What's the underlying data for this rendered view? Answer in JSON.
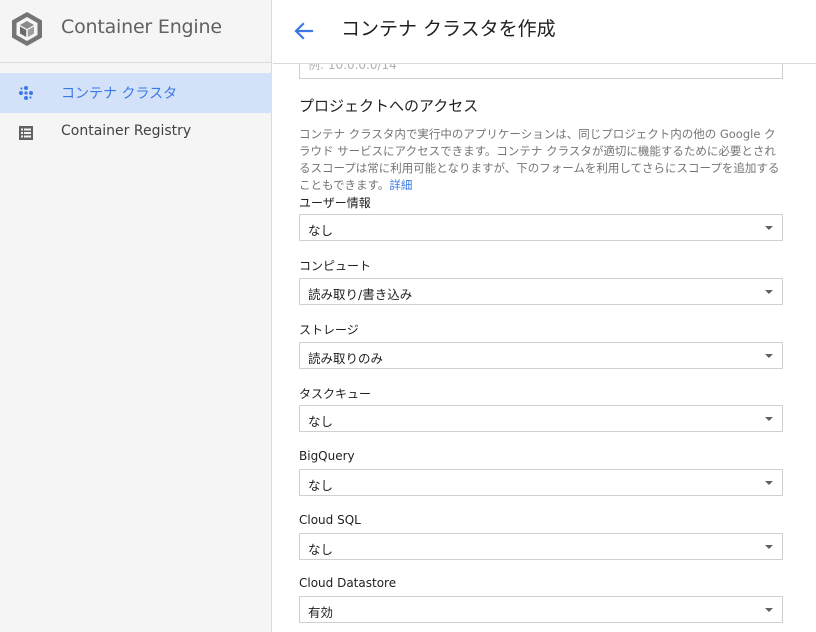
{
  "sidebar": {
    "app_title": "Container Engine",
    "items": [
      {
        "label": "コンテナ クラスタ",
        "icon": "cluster-icon",
        "active": true
      },
      {
        "label": "Container Registry",
        "icon": "registry-list-icon",
        "active": false
      }
    ]
  },
  "header": {
    "title": "コンテナ クラスタを作成",
    "back_icon": "arrow-back-icon"
  },
  "form": {
    "ip_placeholder": "例: 10.0.0.0/14",
    "access_section": {
      "title": "プロジェクトへのアクセス",
      "description": "コンテナ クラスタ内で実行中のアプリケーションは、同じプロジェクト内の他の Google クラウド サービスにアクセスできます。コンテナ クラスタが適切に機能するために必要とされるスコープは常に利用可能となりますが、下のフォームを利用してさらにスコープを追加することもできます。",
      "details_link": "詳細"
    },
    "fields": [
      {
        "label": "ユーザー情報",
        "value": "なし"
      },
      {
        "label": "コンピュート",
        "value": "読み取り/書き込み"
      },
      {
        "label": "ストレージ",
        "value": "読み取りのみ"
      },
      {
        "label": "タスクキュー",
        "value": "なし"
      },
      {
        "label": "BigQuery",
        "value": "なし"
      },
      {
        "label": "Cloud SQL",
        "value": "なし"
      },
      {
        "label": "Cloud Datastore",
        "value": "有効"
      }
    ]
  },
  "colors": {
    "accent": "#3b78e7",
    "active_nav_bg": "#d3e2f8",
    "sidebar_bg": "#f5f5f5"
  }
}
